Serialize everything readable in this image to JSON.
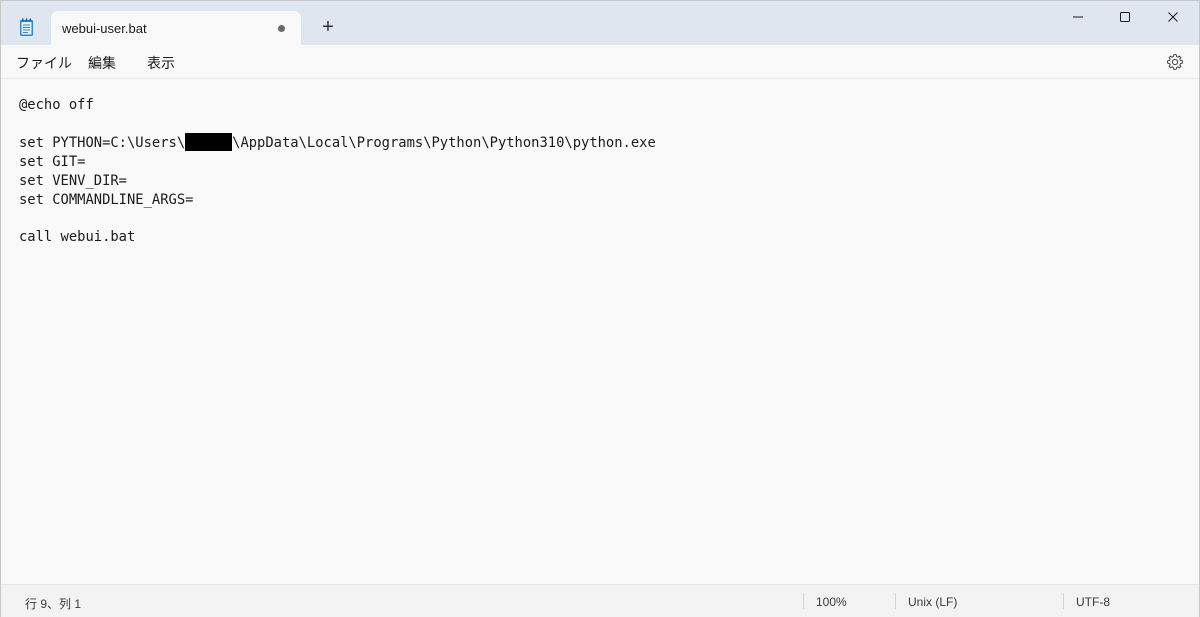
{
  "window": {
    "tab_title": "webui-user.bat",
    "new_tab_label": "+",
    "app_icon": "notepad-icon",
    "controls": [
      "minimize-icon",
      "maximize-icon",
      "close-icon"
    ]
  },
  "menu": {
    "file": "ファイル",
    "edit": "編集",
    "view": "表示",
    "settings_icon": "gear-icon"
  },
  "editor": {
    "lines": {
      "l1": "@echo off",
      "l2": "",
      "l3_prefix": "set PYTHON=C:\\Users\\",
      "l3_suffix": "\\AppData\\Local\\Programs\\Python\\Python310\\python.exe",
      "l4": "set GIT=",
      "l5": "set VENV_DIR=",
      "l6": "set COMMANDLINE_ARGS=",
      "l7": "",
      "l8": "call webui.bat"
    }
  },
  "status": {
    "position": "行 9、列 1",
    "zoom": "100%",
    "line_ending": "Unix (LF)",
    "encoding": "UTF-8"
  }
}
